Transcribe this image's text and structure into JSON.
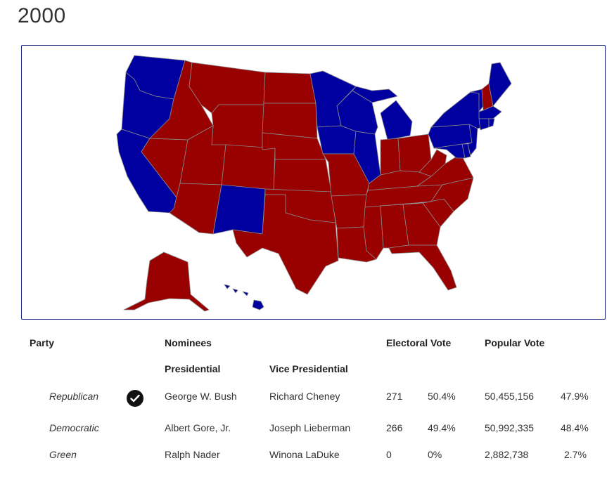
{
  "title": "2000",
  "colors": {
    "republican": "#990000",
    "democratic": "#0000a0",
    "border": "#1a237e"
  },
  "states": {
    "WA": "D",
    "OR": "D",
    "CA": "D",
    "NV": "R",
    "ID": "R",
    "MT": "R",
    "WY": "R",
    "UT": "R",
    "AZ": "R",
    "CO": "R",
    "NM": "D",
    "ND": "R",
    "SD": "R",
    "NE": "R",
    "KS": "R",
    "OK": "R",
    "TX": "R",
    "MN": "D",
    "IA": "D",
    "MO": "R",
    "AR": "R",
    "LA": "R",
    "WI": "D",
    "IL": "D",
    "MI": "D",
    "IN": "R",
    "OH": "R",
    "KY": "R",
    "TN": "R",
    "MS": "R",
    "AL": "R",
    "GA": "R",
    "FL": "R",
    "SC": "R",
    "NC": "R",
    "VA": "R",
    "WV": "R",
    "PA": "D",
    "NY": "D",
    "VT": "D",
    "NH": "R",
    "ME": "D",
    "MA": "D",
    "CT": "D",
    "RI": "D",
    "NJ": "D",
    "DE": "D",
    "MD": "D",
    "DC": "D",
    "AK": "R",
    "HI": "D"
  },
  "table": {
    "headers": {
      "party": "Party",
      "nominees": "Nominees",
      "electoral": "Electoral Vote",
      "popular": "Popular Vote",
      "presidential": "Presidential",
      "vice": "Vice Presidential"
    },
    "rows": [
      {
        "party": "Republican",
        "winner": true,
        "president": "George W. Bush",
        "vice": "Richard Cheney",
        "ev": "271",
        "ev_pct": "50.4%",
        "pv": "50,455,156",
        "pv_pct": "47.9%"
      },
      {
        "party": "Democratic",
        "winner": false,
        "president": "Albert Gore, Jr.",
        "vice": "Joseph Lieberman",
        "ev": "266",
        "ev_pct": "49.4%",
        "pv": "50,992,335",
        "pv_pct": "48.4%"
      },
      {
        "party": "Green",
        "winner": false,
        "president": "Ralph Nader",
        "vice": "Winona LaDuke",
        "ev": "0",
        "ev_pct": "0%",
        "pv": "2,882,738",
        "pv_pct": "2.7%"
      }
    ]
  }
}
